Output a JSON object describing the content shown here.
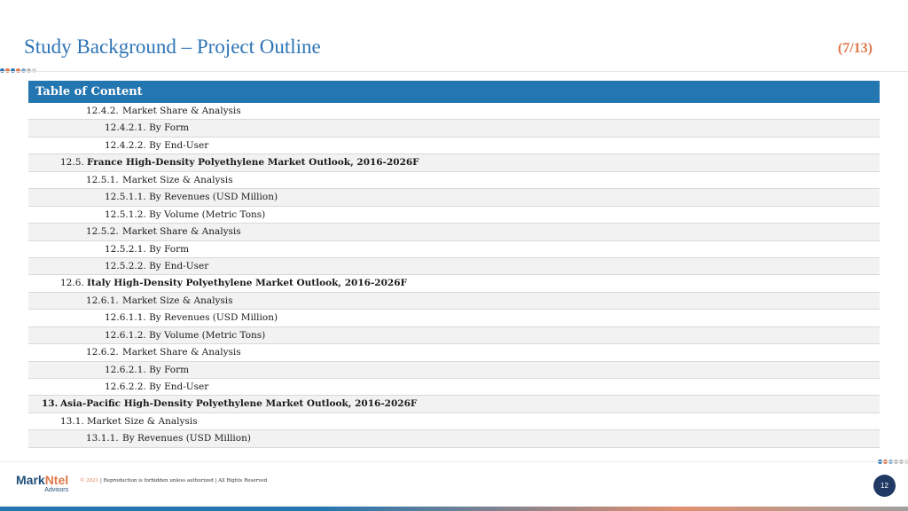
{
  "header": {
    "title": "Study Background – Project Outline",
    "page_indicator": "(7/13)"
  },
  "toc": {
    "heading": "Table of Content",
    "rows": [
      {
        "num": "12.4.2.",
        "label": "Market Share & Analysis"
      },
      {
        "num": "",
        "label": "12.4.2.1. By Form"
      },
      {
        "num": "",
        "label": "12.4.2.2. By End-User"
      },
      {
        "num": "12.5.",
        "label": "France High-Density Polyethylene Market Outlook, 2016-2026F"
      },
      {
        "num": "12.5.1.",
        "label": "Market Size & Analysis"
      },
      {
        "num": "",
        "label": "12.5.1.1. By Revenues (USD Million)"
      },
      {
        "num": "",
        "label": "12.5.1.2. By Volume (Metric Tons)"
      },
      {
        "num": "12.5.2.",
        "label": "Market Share & Analysis"
      },
      {
        "num": "",
        "label": "12.5.2.1. By Form"
      },
      {
        "num": "",
        "label": "12.5.2.2. By End-User"
      },
      {
        "num": "12.6.",
        "label": "Italy High-Density Polyethylene Market Outlook, 2016-2026F"
      },
      {
        "num": "12.6.1.",
        "label": "Market Size & Analysis"
      },
      {
        "num": "",
        "label": "12.6.1.1. By Revenues (USD Million)"
      },
      {
        "num": "",
        "label": "12.6.1.2. By Volume (Metric Tons)"
      },
      {
        "num": "12.6.2.",
        "label": "Market Share & Analysis"
      },
      {
        "num": "",
        "label": "12.6.2.1. By Form"
      },
      {
        "num": "",
        "label": "12.6.2.2. By End-User"
      },
      {
        "num": "13.",
        "label": "Asia-Pacific High-Density Polyethylene Market Outlook, 2016-2026F"
      },
      {
        "num": "13.1.",
        "label": "Market Size & Analysis"
      },
      {
        "num": "13.1.1.",
        "label": "By Revenues (USD Million)"
      }
    ]
  },
  "footer": {
    "logo_primary": "Mark",
    "logo_accent": "Ntel",
    "logo_sub": "Advisors",
    "copyright_year": "© 2021",
    "copyright_text": " | Reproduction is forbidden unless authorized | All Rights Reserved",
    "page_number": "12"
  },
  "colors": {
    "title": "#2e74b5",
    "accent": "#e0784a",
    "table_header": "#2376b0",
    "badge": "#1f3864"
  }
}
